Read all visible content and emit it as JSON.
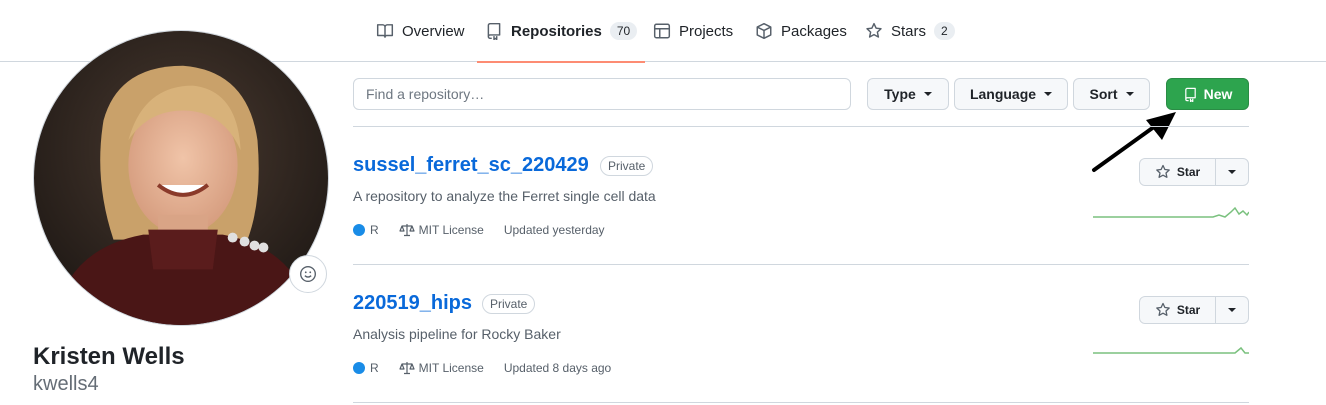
{
  "nav": {
    "tabs": [
      {
        "label": "Overview",
        "icon": "book-icon"
      },
      {
        "label": "Repositories",
        "icon": "repo-icon",
        "count": "70",
        "selected": true
      },
      {
        "label": "Projects",
        "icon": "table-icon"
      },
      {
        "label": "Packages",
        "icon": "package-icon"
      },
      {
        "label": "Stars",
        "icon": "star-icon",
        "count": "2"
      }
    ]
  },
  "profile": {
    "name": "Kristen Wells",
    "login": "kwells4"
  },
  "filters": {
    "search_placeholder": "Find a repository…",
    "type_label": "Type",
    "language_label": "Language",
    "sort_label": "Sort",
    "new_label": "New"
  },
  "repos": [
    {
      "name": "sussel_ferret_sc_220429",
      "visibility": "Private",
      "description": "A repository to analyze the Ferret single cell data",
      "language": "R",
      "license": "MIT License",
      "updated": "Updated yesterday",
      "star_label": "Star"
    },
    {
      "name": "220519_hips",
      "visibility": "Private",
      "description": "Analysis pipeline for Rocky Baker",
      "language": "R",
      "license": "MIT License",
      "updated": "Updated 8 days ago",
      "star_label": "Star"
    }
  ],
  "colors": {
    "accent_tab": "#fd8c73",
    "new_button": "#2da44e",
    "link": "#0969da",
    "lang_r": "#198ce7",
    "sparkline": "#7ac17e"
  }
}
